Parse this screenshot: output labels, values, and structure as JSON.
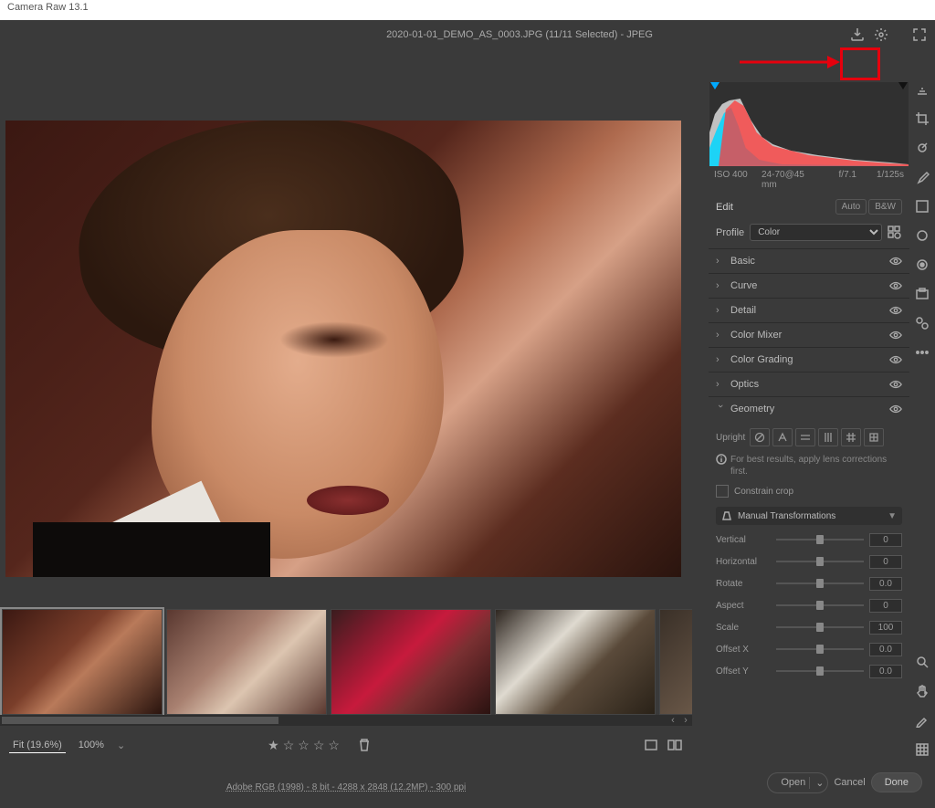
{
  "title": "Camera Raw 13.1",
  "file_info": "2020-01-01_DEMO_AS_0003.JPG (11/11 Selected)  -  JPEG",
  "metadata": {
    "iso": "ISO 400",
    "lens": "24-70@45 mm",
    "aperture": "f/7.1",
    "shutter": "1/125s"
  },
  "edit": {
    "label": "Edit",
    "auto": "Auto",
    "bw": "B&W"
  },
  "profile": {
    "label": "Profile",
    "selected": "Color"
  },
  "sections": {
    "basic": "Basic",
    "curve": "Curve",
    "detail": "Detail",
    "color_mixer": "Color Mixer",
    "color_grading": "Color Grading",
    "optics": "Optics",
    "geometry": "Geometry"
  },
  "geometry": {
    "upright": "Upright",
    "hint": "For best results, apply lens corrections first.",
    "constrain": "Constrain crop",
    "mt_header": "Manual Transformations",
    "sliders": [
      {
        "label": "Vertical",
        "value": "0"
      },
      {
        "label": "Horizontal",
        "value": "0"
      },
      {
        "label": "Rotate",
        "value": "0.0"
      },
      {
        "label": "Aspect",
        "value": "0"
      },
      {
        "label": "Scale",
        "value": "100"
      },
      {
        "label": "Offset X",
        "value": "0.0"
      },
      {
        "label": "Offset Y",
        "value": "0.0"
      }
    ]
  },
  "zoom": {
    "fit": "Fit (19.6%)",
    "pct": "100%"
  },
  "bottom_info": "Adobe RGB (1998) - 8 bit - 4288 x 2848 (12.2MP) - 300 ppi",
  "buttons": {
    "open": "Open",
    "cancel": "Cancel",
    "done": "Done"
  }
}
